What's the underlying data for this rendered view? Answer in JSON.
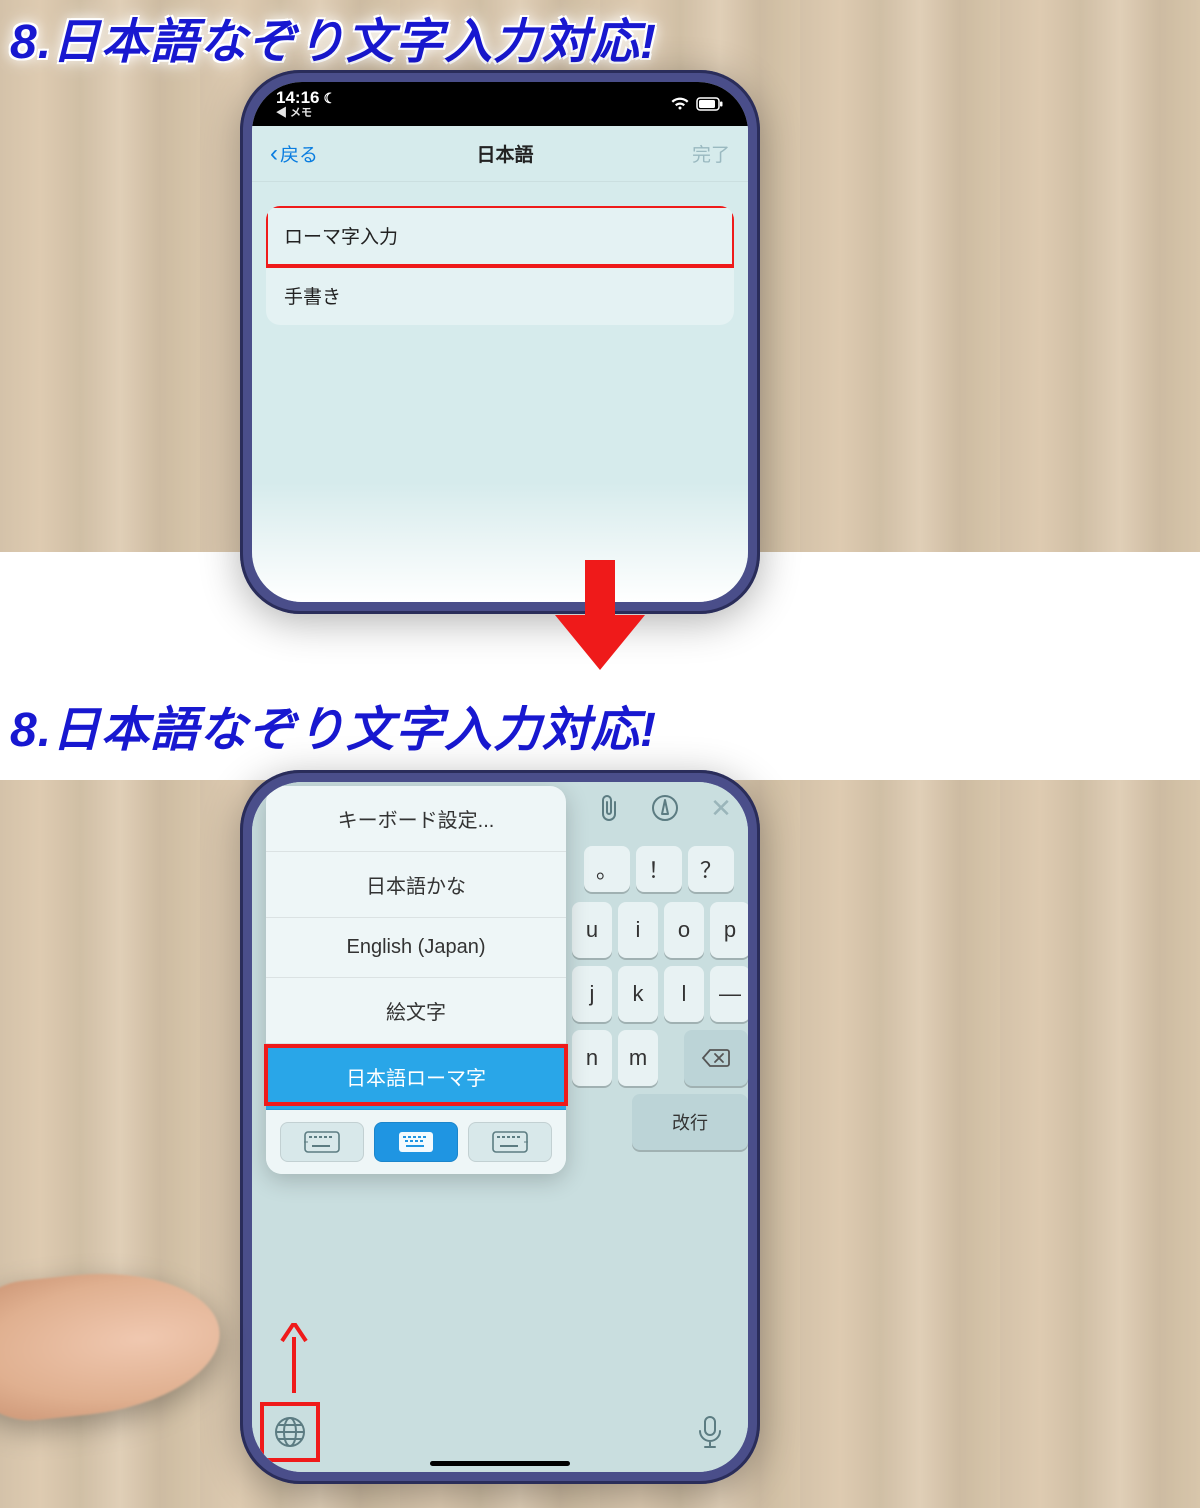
{
  "caption1": "8.日本語なぞり文字入力対応!",
  "caption2": "8.日本語なぞり文字入力対応!",
  "status": {
    "time": "14:16",
    "back_app": "◀ メモ"
  },
  "nav": {
    "back": "戻る",
    "title": "日本語",
    "done": "完了"
  },
  "settings_list": {
    "items": [
      "ローマ字入力",
      "手書き"
    ]
  },
  "keyboard_popup": {
    "items": [
      "キーボード設定...",
      "日本語かな",
      "English (Japan)",
      "絵文字",
      "日本語ローマ字"
    ],
    "selected_index": 4
  },
  "kb_punct": [
    "。",
    "！",
    "？"
  ],
  "kb_row2": [
    "u",
    "i",
    "o",
    "p"
  ],
  "kb_row3": [
    "j",
    "k",
    "l",
    "—"
  ],
  "kb_row4": [
    "n",
    "m"
  ],
  "kb_return": "改行"
}
